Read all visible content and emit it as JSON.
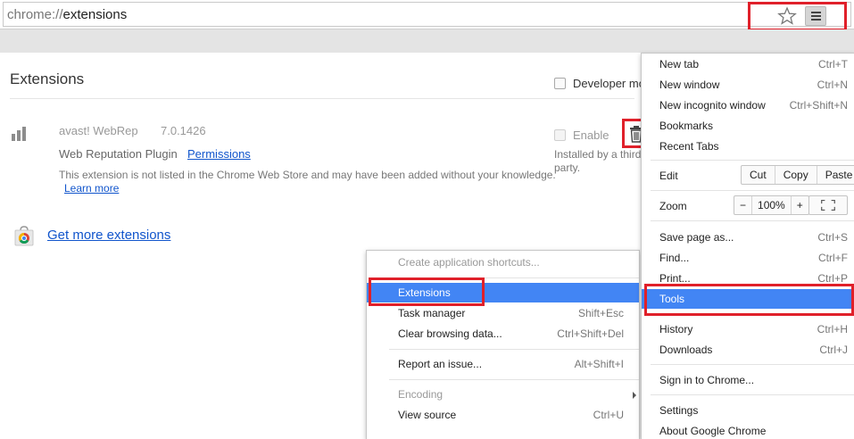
{
  "omnibox": {
    "scheme": "chrome://",
    "path": "extensions"
  },
  "page": {
    "title": "Extensions",
    "developer_mode": "Developer mode",
    "get_more": "Get more extensions"
  },
  "extension": {
    "name": "avast! WebRep",
    "version": "7.0.1426",
    "description": "Web Reputation Plugin",
    "permissions": "Permissions",
    "warning": "This extension is not listed in the Chrome Web Store and may have been added without your knowledge.",
    "learn_more": "Learn more",
    "enable": "Enable",
    "installed_note": "Installed by a third party."
  },
  "main_menu": {
    "new_tab": {
      "label": "New tab",
      "shortcut": "Ctrl+T"
    },
    "new_window": {
      "label": "New window",
      "shortcut": "Ctrl+N"
    },
    "new_incognito": {
      "label": "New incognito window",
      "shortcut": "Ctrl+Shift+N"
    },
    "bookmarks": {
      "label": "Bookmarks"
    },
    "recent_tabs": {
      "label": "Recent Tabs"
    },
    "edit": {
      "label": "Edit",
      "cut": "Cut",
      "copy": "Copy",
      "paste": "Paste"
    },
    "zoom": {
      "label": "Zoom",
      "minus": "−",
      "level": "100%",
      "plus": "+"
    },
    "save_page": {
      "label": "Save page as...",
      "shortcut": "Ctrl+S"
    },
    "find": {
      "label": "Find...",
      "shortcut": "Ctrl+F"
    },
    "print": {
      "label": "Print...",
      "shortcut": "Ctrl+P"
    },
    "tools": {
      "label": "Tools"
    },
    "history": {
      "label": "History",
      "shortcut": "Ctrl+H"
    },
    "downloads": {
      "label": "Downloads",
      "shortcut": "Ctrl+J"
    },
    "sign_in": {
      "label": "Sign in to Chrome..."
    },
    "settings": {
      "label": "Settings"
    },
    "about": {
      "label": "About Google Chrome"
    }
  },
  "tools_menu": {
    "create_shortcuts": {
      "label": "Create application shortcuts..."
    },
    "extensions": {
      "label": "Extensions"
    },
    "task_manager": {
      "label": "Task manager",
      "shortcut": "Shift+Esc"
    },
    "clear_data": {
      "label": "Clear browsing data...",
      "shortcut": "Ctrl+Shift+Del"
    },
    "report_issue": {
      "label": "Report an issue...",
      "shortcut": "Alt+Shift+I"
    },
    "encoding": {
      "label": "Encoding"
    },
    "view_source": {
      "label": "View source",
      "shortcut": "Ctrl+U"
    }
  },
  "colors": {
    "menu_highlight": "#4285f4",
    "annotation_red": "#e0202a",
    "link": "#1155cc"
  },
  "icons": [
    "star-icon",
    "chrome-menu-icon",
    "trash-icon",
    "webrep-bars-icon",
    "chrome-web-store-icon",
    "fullscreen-icon",
    "submenu-arrow-icon"
  ]
}
